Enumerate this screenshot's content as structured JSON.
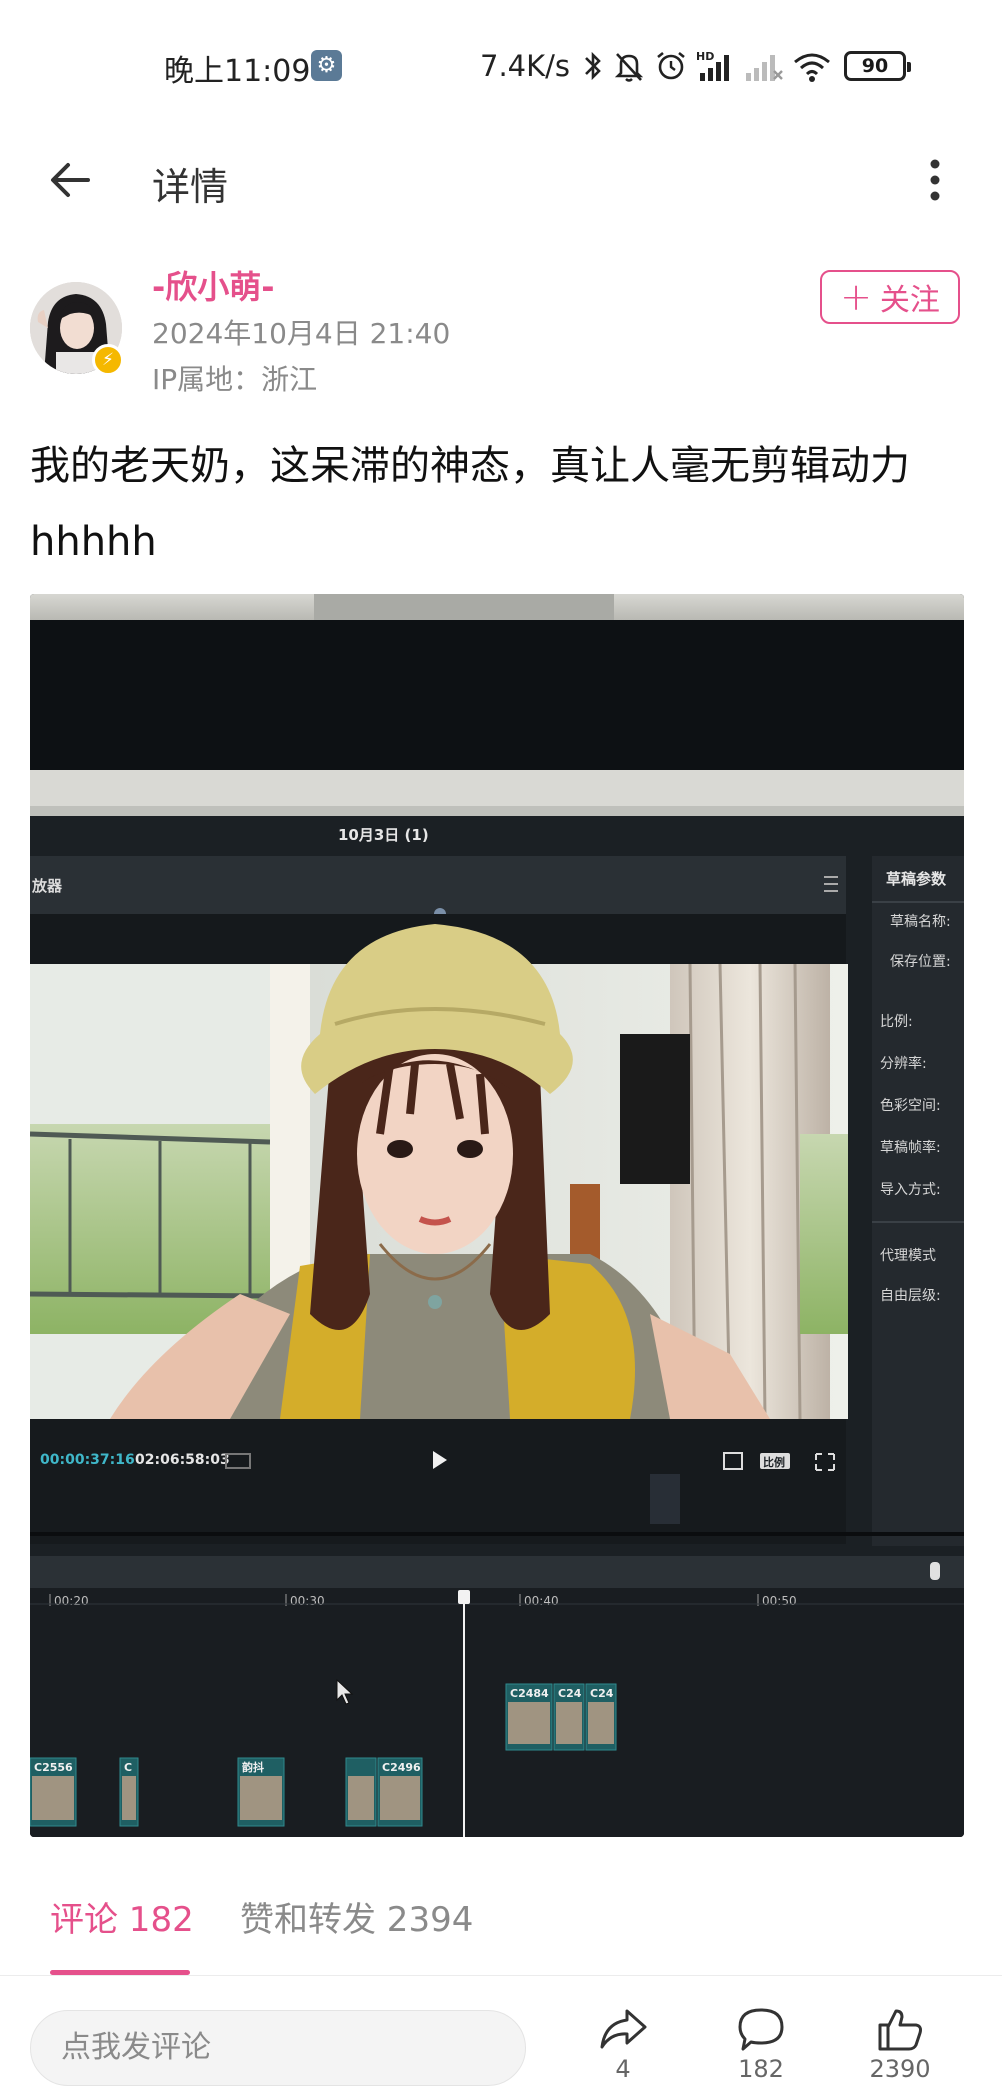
{
  "status_bar": {
    "time": "晚上11:09",
    "net_speed": "7.4K/s",
    "battery": "90",
    "icons": [
      "settings-icon",
      "bluetooth-icon",
      "mute-bell-icon",
      "alarm-icon",
      "hd-signal-icon",
      "signal-icon",
      "wifi-icon",
      "battery-icon"
    ]
  },
  "header": {
    "title": "详情",
    "back_icon": "back-arrow-icon",
    "more_icon": "more-vertical-icon"
  },
  "author": {
    "name": "-欣小萌-",
    "time": "2024年10月4日 21:40",
    "ip_location": "IP属地：浙江",
    "follow_label": "关注",
    "accent_color": "#e5508b"
  },
  "post": {
    "text": "我的老天奶，这呆滞的神态，真让人毫无剪辑动力hhhhh"
  },
  "image": {
    "project_title": "10月3日 (1)",
    "player_label": "放器",
    "panel_title": "草稿参数",
    "panel_fields": [
      "草稿名称:",
      "保存位置:",
      "比例:",
      "分辨率:",
      "色彩空间:",
      "草稿帧率:",
      "导入方式:",
      "代理模式",
      "自由层级:"
    ],
    "timecode_current": "00:00:37:16",
    "timecode_total": "02:06:58:03",
    "ratio_label": "比例",
    "ruler_marks": [
      "00:20",
      "00:30",
      "00:40",
      "00:50"
    ],
    "clips_top": [
      "C2484",
      "C24",
      "C24"
    ],
    "clips_bottom": [
      "C2556",
      "C",
      "韵抖",
      "",
      "C2496"
    ]
  },
  "tabs": {
    "comments": "评论 182",
    "likes_reposts": "赞和转发 2394"
  },
  "bottom_bar": {
    "placeholder": "点我发评论",
    "share_count": "4",
    "comment_count": "182",
    "like_count": "2390"
  }
}
